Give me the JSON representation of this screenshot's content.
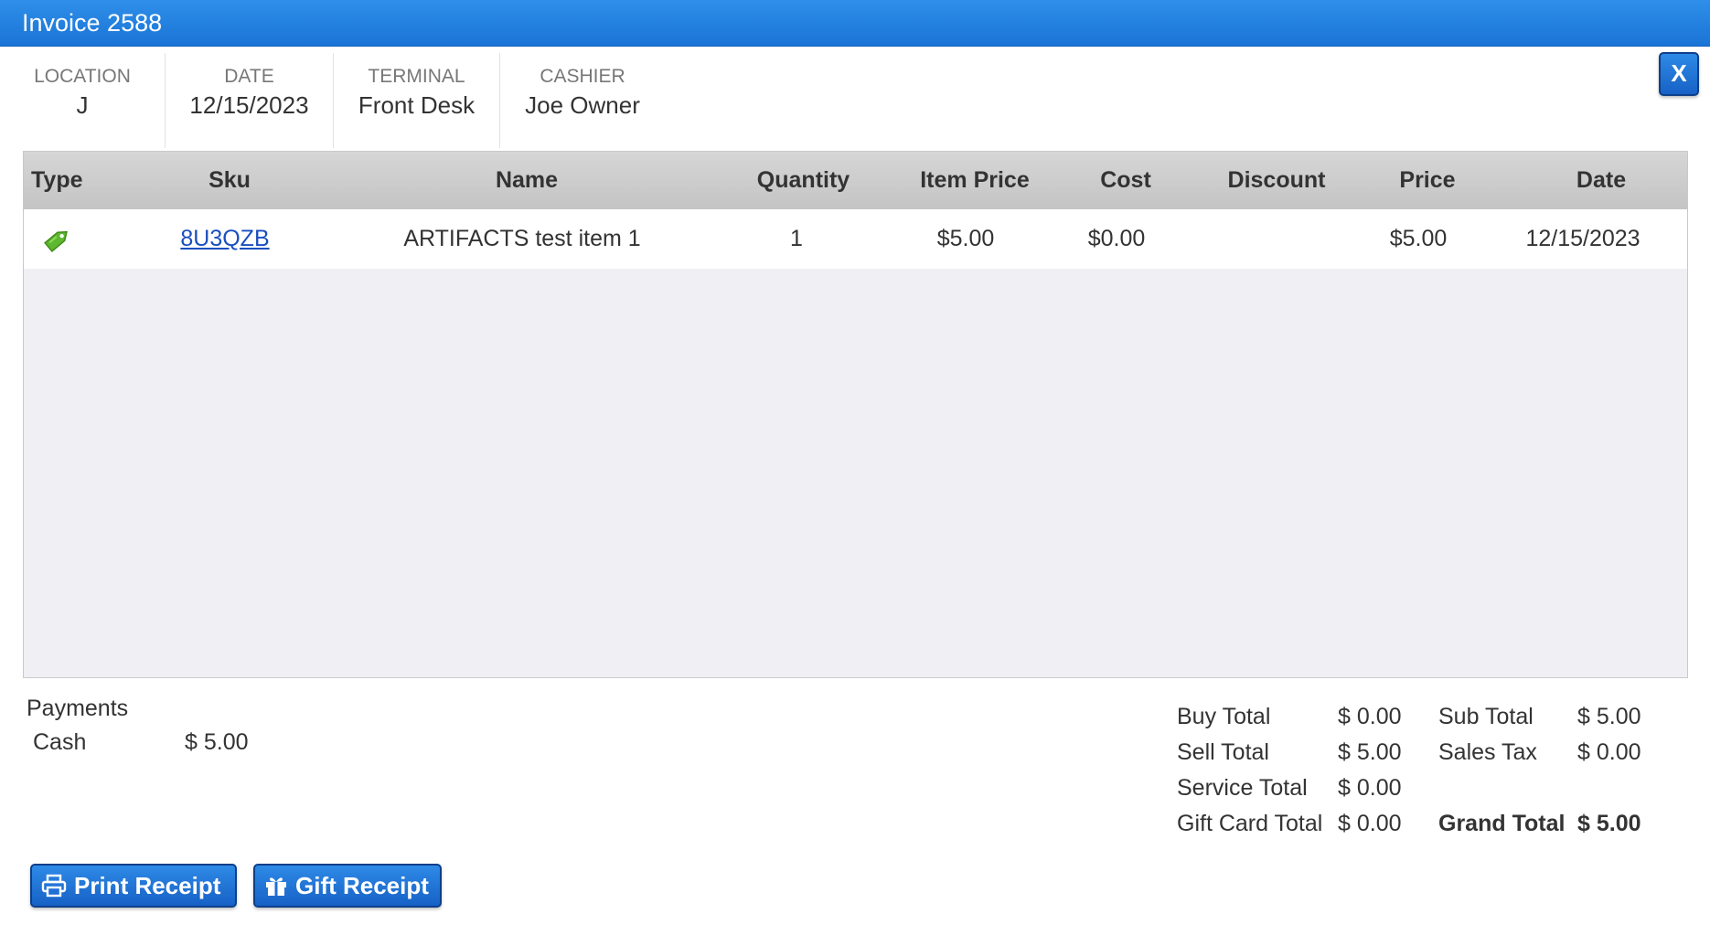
{
  "window": {
    "title": "Invoice 2588",
    "close_label": "X"
  },
  "info": [
    {
      "label": "LOCATION",
      "value": "J"
    },
    {
      "label": "DATE",
      "value": "12/15/2023"
    },
    {
      "label": "TERMINAL",
      "value": "Front Desk"
    },
    {
      "label": "CASHIER",
      "value": "Joe Owner"
    }
  ],
  "table": {
    "columns": [
      "Type",
      "Sku",
      "Name",
      "Quantity",
      "Item Price",
      "Cost",
      "Discount",
      "Price",
      "Date"
    ],
    "rows": [
      {
        "type_icon": "tag-icon",
        "sku": "8U3QZB",
        "name": "ARTIFACTS test item 1",
        "quantity": "1",
        "item_price": "$5.00",
        "cost": "$0.00",
        "discount": "",
        "price": "$5.00",
        "date": "12/15/2023"
      }
    ]
  },
  "payments": {
    "title": "Payments",
    "items": [
      {
        "method": "Cash",
        "amount": "$ 5.00"
      }
    ]
  },
  "totals": {
    "buy_total_label": "Buy Total",
    "buy_total": "$ 0.00",
    "sell_total_label": "Sell Total",
    "sell_total": "$ 5.00",
    "service_total_label": "Service Total",
    "service_total": "$ 0.00",
    "gift_card_total_label": "Gift Card Total",
    "gift_card_total": "$ 0.00",
    "sub_total_label": "Sub Total",
    "sub_total": "$ 5.00",
    "sales_tax_label": "Sales Tax",
    "sales_tax": "$ 0.00",
    "grand_total_label": "Grand Total",
    "grand_total": "$ 5.00"
  },
  "buttons": {
    "print_receipt": "Print Receipt",
    "gift_receipt": "Gift Receipt"
  },
  "colors": {
    "titlebar": "#1a74d6",
    "button": "#1f6fd6",
    "tag_icon": "#5cb82e",
    "link": "#1a4fbf"
  }
}
